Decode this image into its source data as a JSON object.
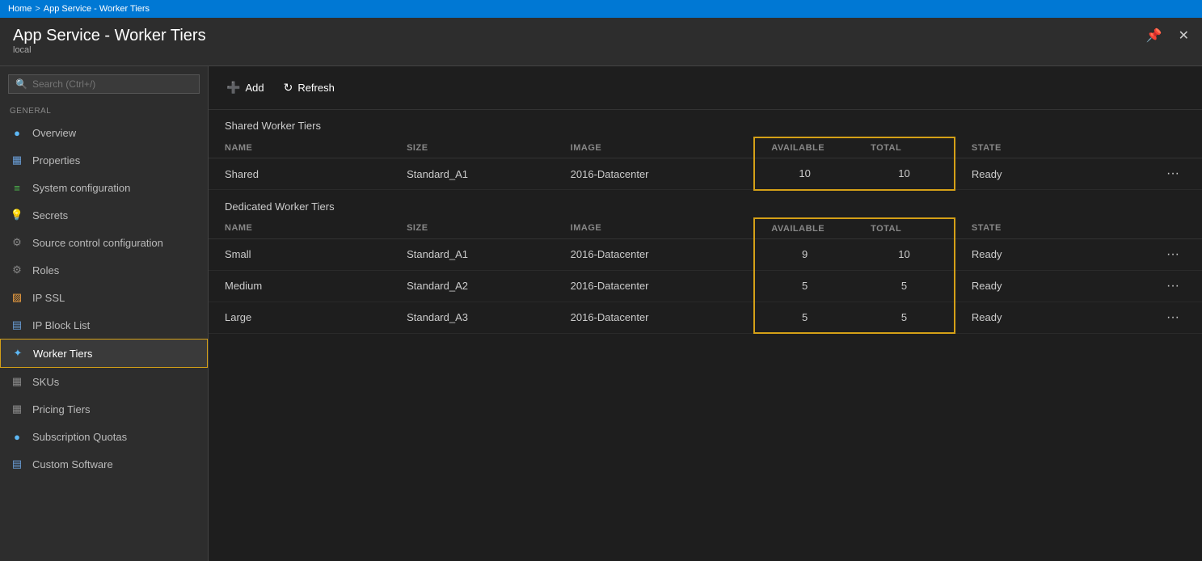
{
  "topbar": {
    "home": "Home",
    "sep": ">",
    "current": "App Service - Worker Tiers"
  },
  "titlebar": {
    "title": "App Service - Worker Tiers",
    "subtitle": "local",
    "pin_label": "📌",
    "close_label": "✕"
  },
  "sidebar": {
    "search_placeholder": "Search (Ctrl+/)",
    "general_label": "GENERAL",
    "items": [
      {
        "id": "overview",
        "label": "Overview",
        "icon": "●"
      },
      {
        "id": "properties",
        "label": "Properties",
        "icon": "▦"
      },
      {
        "id": "sysconfg",
        "label": "System configuration",
        "icon": "≡≡"
      },
      {
        "id": "secrets",
        "label": "Secrets",
        "icon": "💡"
      },
      {
        "id": "source",
        "label": "Source control configuration",
        "icon": "⚙"
      },
      {
        "id": "roles",
        "label": "Roles",
        "icon": "⚙"
      },
      {
        "id": "ipssl",
        "label": "IP SSL",
        "icon": "▨"
      },
      {
        "id": "ipblock",
        "label": "IP Block List",
        "icon": "▤"
      },
      {
        "id": "worker",
        "label": "Worker Tiers",
        "icon": "✦",
        "active": true
      },
      {
        "id": "skus",
        "label": "SKUs",
        "icon": "▦"
      },
      {
        "id": "pricing",
        "label": "Pricing Tiers",
        "icon": "▦"
      },
      {
        "id": "subscription",
        "label": "Subscription Quotas",
        "icon": "●"
      },
      {
        "id": "custom",
        "label": "Custom Software",
        "icon": "▤"
      }
    ]
  },
  "toolbar": {
    "add_label": "Add",
    "refresh_label": "Refresh"
  },
  "shared_section": {
    "title": "Shared Worker Tiers",
    "columns": {
      "name": "NAME",
      "size": "SIZE",
      "image": "IMAGE",
      "available": "AVAILABLE",
      "total": "TOTAL",
      "state": "STATE"
    },
    "rows": [
      {
        "name": "Shared",
        "size": "Standard_A1",
        "image": "2016-Datacenter",
        "available": "10",
        "total": "10",
        "state": "Ready"
      }
    ]
  },
  "dedicated_section": {
    "title": "Dedicated Worker Tiers",
    "columns": {
      "name": "NAME",
      "size": "SIZE",
      "image": "IMAGE",
      "available": "AVAILABLE",
      "total": "TOTAL",
      "state": "STATE"
    },
    "rows": [
      {
        "name": "Small",
        "size": "Standard_A1",
        "image": "2016-Datacenter",
        "available": "9",
        "total": "10",
        "state": "Ready"
      },
      {
        "name": "Medium",
        "size": "Standard_A2",
        "image": "2016-Datacenter",
        "available": "5",
        "total": "5",
        "state": "Ready"
      },
      {
        "name": "Large",
        "size": "Standard_A3",
        "image": "2016-Datacenter",
        "available": "5",
        "total": "5",
        "state": "Ready"
      }
    ]
  }
}
